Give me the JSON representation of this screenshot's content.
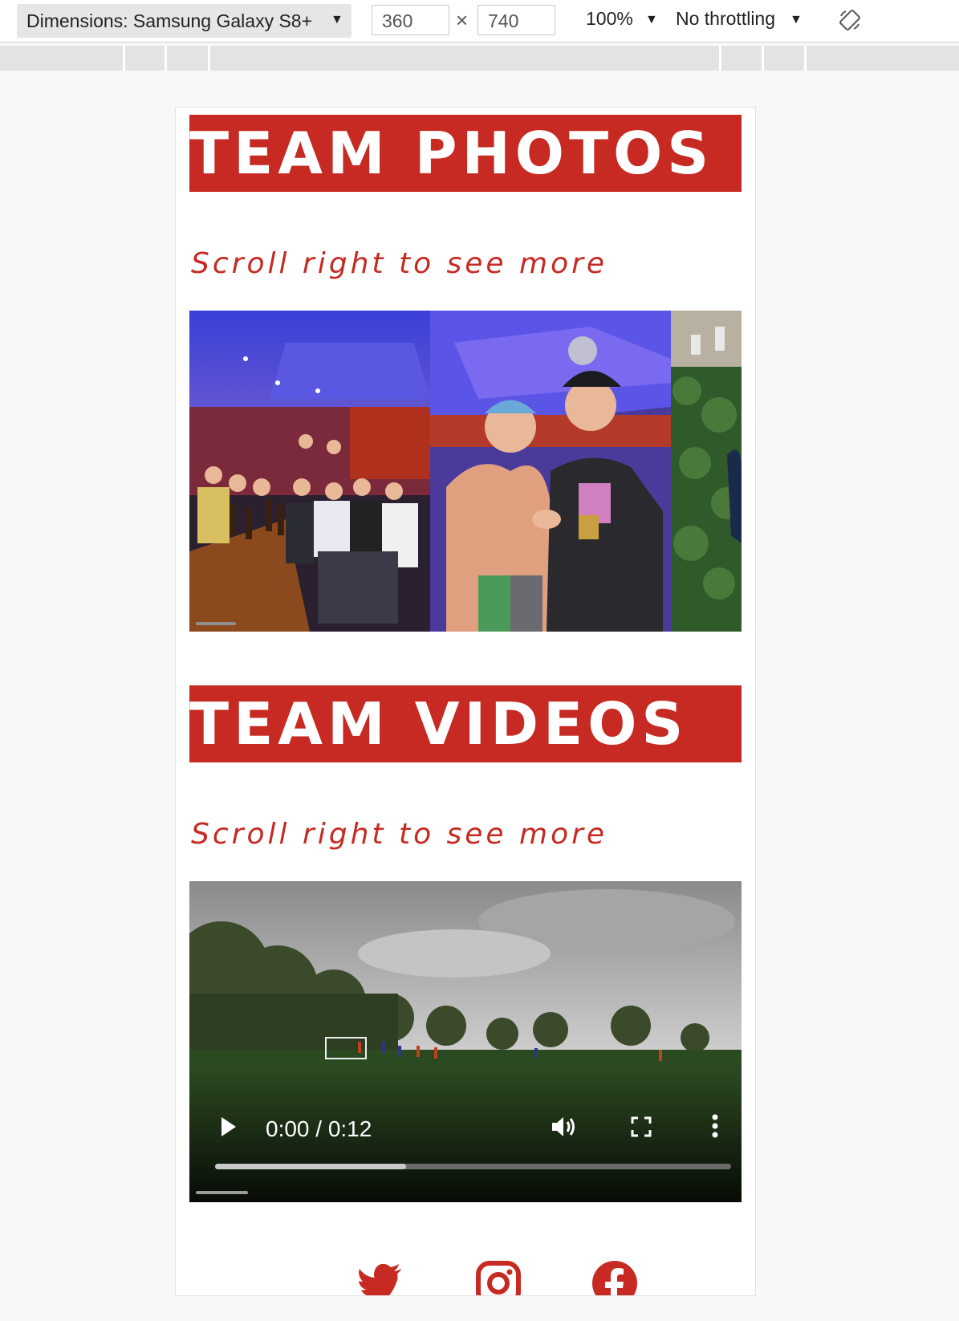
{
  "toolbar": {
    "device_label": "Dimensions: Samsung Galaxy S8+",
    "width": "360",
    "height": "740",
    "times": "×",
    "zoom": "100%",
    "throttling": "No throttling"
  },
  "icons": {
    "caret": "▼",
    "rotate": "rotate-icon",
    "play": "play-icon",
    "volume": "volume-icon",
    "fullscreen": "fullscreen-icon",
    "more": "more-options-icon",
    "twitter": "twitter-icon",
    "instagram": "instagram-icon",
    "facebook": "facebook-icon"
  },
  "colors": {
    "brand_red": "#c62a22"
  },
  "photos_section": {
    "title": "TEAM PHOTOS",
    "hint": "Scroll right to see more"
  },
  "videos_section": {
    "title": "TEAM VIDEOS",
    "hint": "Scroll right to see more",
    "video": {
      "time": "0:00 / 0:12",
      "progress": 0.37
    }
  }
}
